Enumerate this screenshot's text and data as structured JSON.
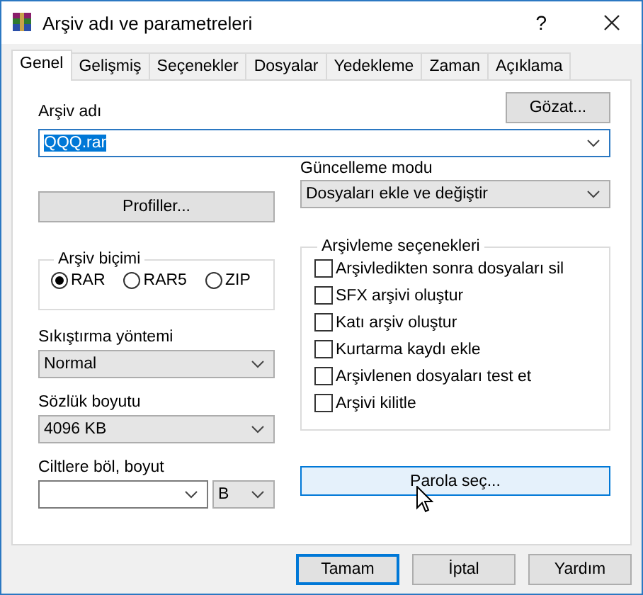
{
  "window": {
    "title": "Arşiv adı ve parametreleri",
    "help_button": "?"
  },
  "tabs": [
    {
      "label": "Genel",
      "selected": true
    },
    {
      "label": "Gelişmiş",
      "selected": false
    },
    {
      "label": "Seçenekler",
      "selected": false
    },
    {
      "label": "Dosyalar",
      "selected": false
    },
    {
      "label": "Yedekleme",
      "selected": false
    },
    {
      "label": "Zaman",
      "selected": false
    },
    {
      "label": "Açıklama",
      "selected": false
    }
  ],
  "archive_name": {
    "label": "Arşiv adı",
    "value": "QQQ.rar",
    "text_selected": true
  },
  "browse_button": "Gözat...",
  "profiles_button": "Profiller...",
  "update_mode": {
    "label": "Güncelleme modu",
    "value": "Dosyaları ekle ve değiştir",
    "editable": false
  },
  "archive_format": {
    "label": "Arşiv biçimi",
    "options": [
      {
        "label": "RAR",
        "selected": true
      },
      {
        "label": "RAR5",
        "selected": false
      },
      {
        "label": "ZIP",
        "selected": false
      }
    ]
  },
  "compression_method": {
    "label": "Sıkıştırma yöntemi",
    "value": "Normal",
    "editable": false
  },
  "dictionary_size": {
    "label": "Sözlük boyutu",
    "value": "4096 KB",
    "editable": false
  },
  "split_volumes": {
    "label": "Ciltlere böl, boyut",
    "unit": "B"
  },
  "archiving_options": {
    "label": "Arşivleme seçenekleri",
    "items": [
      {
        "label": "Arşivledikten sonra dosyaları sil",
        "checked": false
      },
      {
        "label": "SFX arşivi oluştur",
        "checked": false
      },
      {
        "label": "Katı arşiv oluştur",
        "checked": false
      },
      {
        "label": "Kurtarma kaydı ekle",
        "checked": false
      },
      {
        "label": "Arşivlenen dosyaları test et",
        "checked": false
      },
      {
        "label": "Arşivi kilitle",
        "checked": false
      }
    ]
  },
  "password_button": {
    "label": "Parola seç...",
    "hovered": true
  },
  "buttons": [
    {
      "label": "Tamam",
      "default": true
    },
    {
      "label": "İptal",
      "default": false
    },
    {
      "label": "Yardım",
      "default": false
    }
  ]
}
